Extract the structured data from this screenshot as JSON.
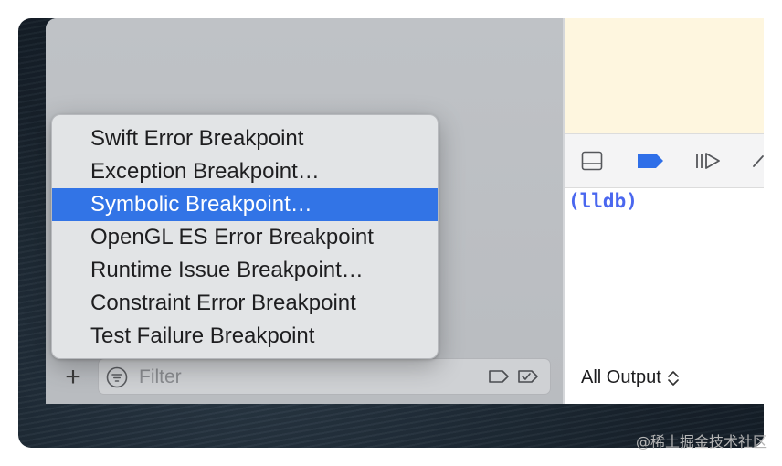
{
  "menu": {
    "items": [
      {
        "label": "Swift Error Breakpoint",
        "highlighted": false
      },
      {
        "label": "Exception Breakpoint…",
        "highlighted": false
      },
      {
        "label": "Symbolic Breakpoint…",
        "highlighted": true
      },
      {
        "label": "OpenGL ES Error Breakpoint",
        "highlighted": false
      },
      {
        "label": "Runtime Issue Breakpoint…",
        "highlighted": false
      },
      {
        "label": "Constraint Error Breakpoint",
        "highlighted": false
      },
      {
        "label": "Test Failure Breakpoint",
        "highlighted": false
      }
    ]
  },
  "navigator_footer": {
    "add_icon": "plus-icon",
    "add_glyph": "+",
    "filter_placeholder": "Filter",
    "filter_value": ""
  },
  "console": {
    "prompt": "(lldb)",
    "output_selector": "All Output",
    "selector_glyph": "⌃⌄"
  },
  "watermark": "@稀土掘金技术社区",
  "colors": {
    "highlight": "#3274e6",
    "lldb_prompt": "#4a67ef",
    "breakpoint_active": "#2f6fe8",
    "editor_bg": "#fef6df"
  }
}
